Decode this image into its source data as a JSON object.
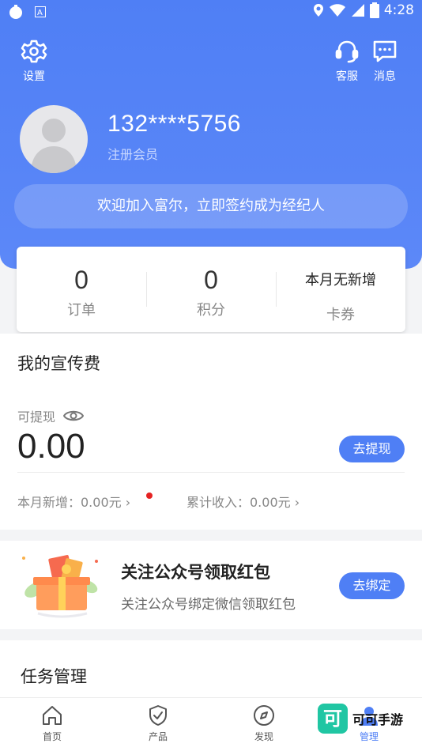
{
  "status_bar": {
    "time": "4:28"
  },
  "header": {
    "settings_label": "设置",
    "service_label": "客服",
    "messages_label": "消息",
    "phone": "132****5756",
    "member_level": "注册会员",
    "welcome_banner": "欢迎加入富尔，立即签约成为经纪人"
  },
  "stats": [
    {
      "value": "0",
      "label": "订单"
    },
    {
      "value": "0",
      "label": "积分"
    },
    {
      "value": "本月无新增",
      "label": "卡券"
    }
  ],
  "fee": {
    "title": "我的宣传费",
    "withdrawable_label": "可提现",
    "amount": "0.00",
    "withdraw_button": "去提现",
    "month_new": "本月新增：0.00元",
    "total_income": "累计收入：0.00元"
  },
  "wechat": {
    "title": "关注公众号领取红包",
    "subtitle": "关注公众号绑定微信领取红包",
    "bind_button": "去绑定"
  },
  "tasks": {
    "title": "任务管理"
  },
  "tabbar": [
    {
      "label": "首页",
      "icon": "home-icon"
    },
    {
      "label": "产品",
      "icon": "shield-icon"
    },
    {
      "label": "发现",
      "icon": "compass-icon"
    },
    {
      "label": "管理",
      "icon": "person-icon",
      "active": true
    }
  ],
  "watermark": {
    "logo_char": "可",
    "text": "可可手游"
  },
  "colors": {
    "primary": "#4f7ff5",
    "badge_red": "#e52222"
  }
}
